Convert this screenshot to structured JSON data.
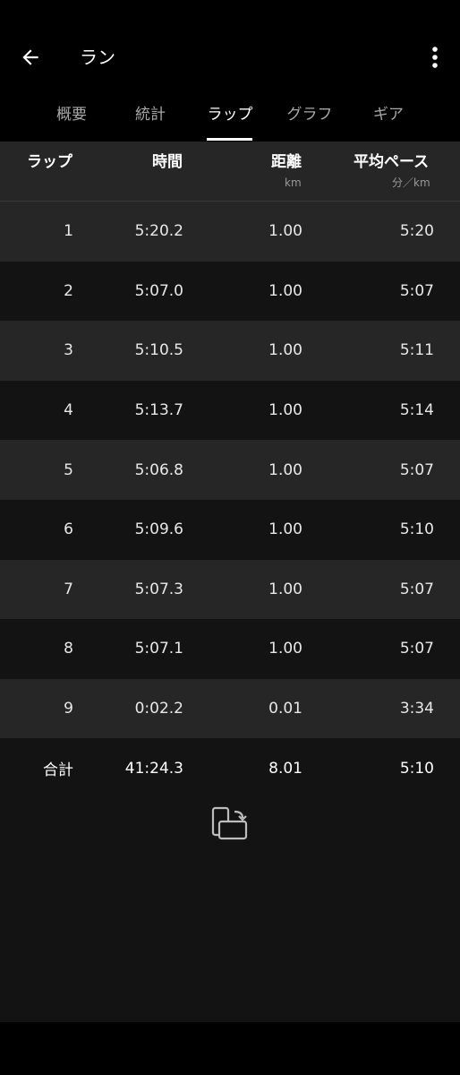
{
  "appbar": {
    "title": "ラン",
    "back_icon": "arrow-left-icon",
    "more_icon": "more-vertical-icon"
  },
  "tabs": [
    {
      "label": "概要",
      "active": false
    },
    {
      "label": "統計",
      "active": false
    },
    {
      "label": "ラップ",
      "active": true
    },
    {
      "label": "グラフ",
      "active": false
    },
    {
      "label": "ギア",
      "active": false
    }
  ],
  "table": {
    "headers": {
      "lap": "ラップ",
      "time": "時間",
      "distance": "距離",
      "distance_unit": "km",
      "pace": "平均ペース",
      "pace_unit": "分／km"
    },
    "rows": [
      {
        "lap": "1",
        "time": "5:20.2",
        "distance": "1.00",
        "pace": "5:20"
      },
      {
        "lap": "2",
        "time": "5:07.0",
        "distance": "1.00",
        "pace": "5:07"
      },
      {
        "lap": "3",
        "time": "5:10.5",
        "distance": "1.00",
        "pace": "5:11"
      },
      {
        "lap": "4",
        "time": "5:13.7",
        "distance": "1.00",
        "pace": "5:14"
      },
      {
        "lap": "5",
        "time": "5:06.8",
        "distance": "1.00",
        "pace": "5:07"
      },
      {
        "lap": "6",
        "time": "5:09.6",
        "distance": "1.00",
        "pace": "5:10"
      },
      {
        "lap": "7",
        "time": "5:07.3",
        "distance": "1.00",
        "pace": "5:07"
      },
      {
        "lap": "8",
        "time": "5:07.1",
        "distance": "1.00",
        "pace": "5:07"
      },
      {
        "lap": "9",
        "time": "0:02.2",
        "distance": "0.01",
        "pace": "3:34"
      }
    ],
    "total": {
      "lap": "合計",
      "time": "41:24.3",
      "distance": "8.01",
      "pace": "5:10"
    }
  },
  "rotate_icon": "screen-rotation-icon",
  "colors": {
    "background": "#000000",
    "row_light": "#262626",
    "row_dark": "#131313",
    "text": "#ffffff",
    "muted": "#9a9a9a"
  }
}
